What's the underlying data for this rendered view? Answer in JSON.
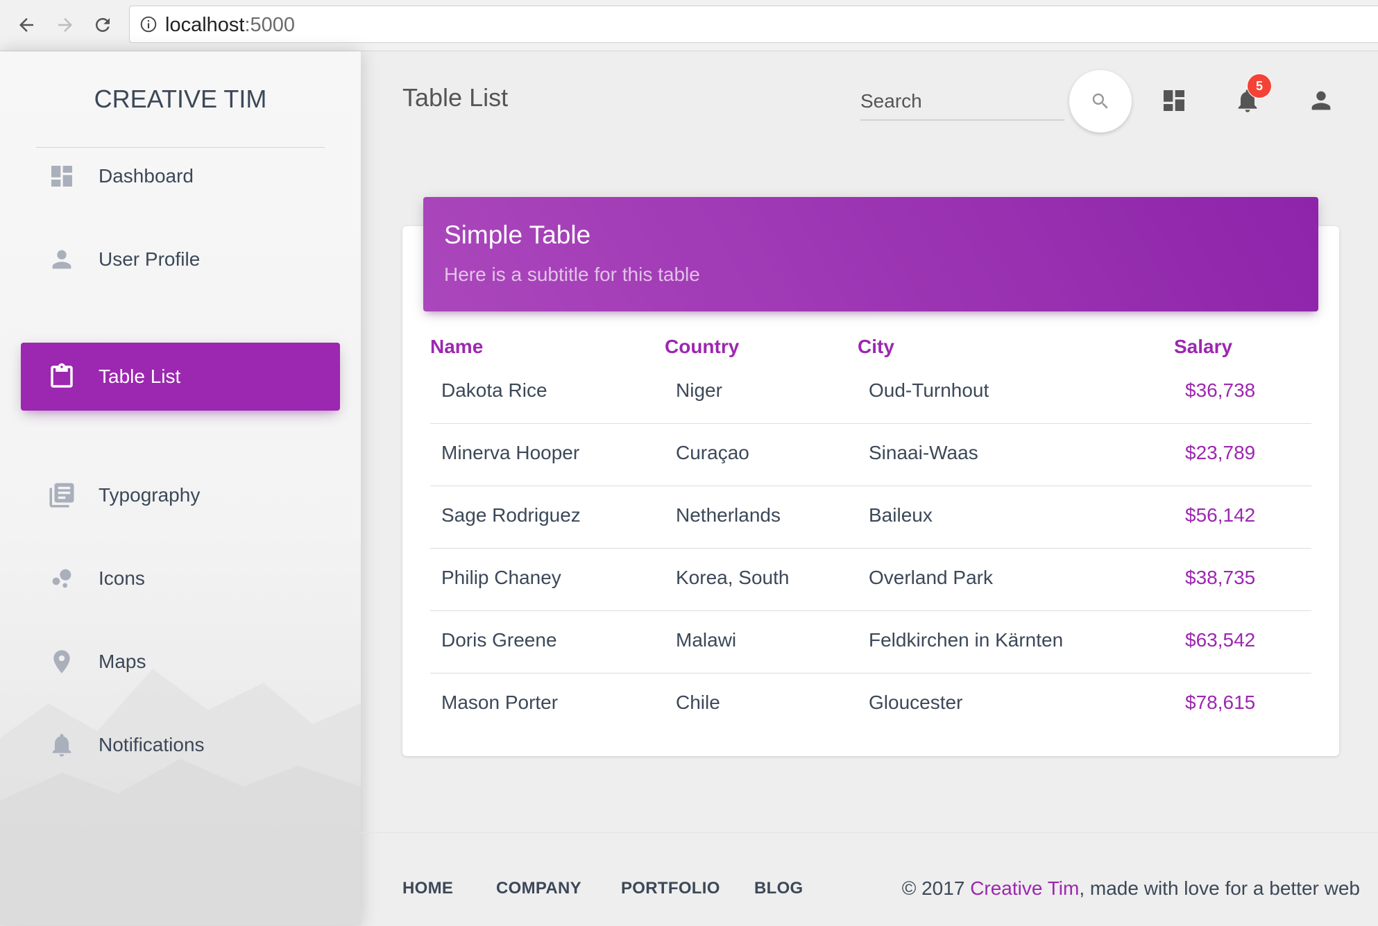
{
  "browser": {
    "url_host": "localhost",
    "url_port": ":5000",
    "icons": [
      "back-arrow-icon",
      "forward-arrow-icon",
      "reload-icon",
      "info-icon"
    ]
  },
  "sidebar": {
    "brand": "CREATIVE TIM",
    "active_color": "#9c27b0",
    "items": [
      {
        "label": "Dashboard",
        "icon": "dashboard-icon",
        "active": false
      },
      {
        "label": "User Profile",
        "icon": "person-icon",
        "active": false
      },
      {
        "label": "Table List",
        "icon": "clipboard-icon",
        "active": true
      },
      {
        "label": "Typography",
        "icon": "library-books-icon",
        "active": false
      },
      {
        "label": "Icons",
        "icon": "bubble-chart-icon",
        "active": false
      },
      {
        "label": "Maps",
        "icon": "location-pin-icon",
        "active": false
      },
      {
        "label": "Notifications",
        "icon": "bell-icon",
        "active": false
      }
    ]
  },
  "header": {
    "title": "Table List",
    "search_placeholder": "Search",
    "notification_count": "5",
    "icons": [
      "search-icon",
      "dashboard-icon",
      "bell-icon",
      "person-icon"
    ]
  },
  "card": {
    "title": "Simple Table",
    "subtitle": "Here is a subtitle for this table",
    "header_gradient": [
      "#ab47bc",
      "#8e24aa"
    ],
    "columns": [
      "Name",
      "Country",
      "City",
      "Salary"
    ],
    "rows": [
      [
        "Dakota Rice",
        "Niger",
        "Oud-Turnhout",
        "$36,738"
      ],
      [
        "Minerva Hooper",
        "Curaçao",
        "Sinaai-Waas",
        "$23,789"
      ],
      [
        "Sage Rodriguez",
        "Netherlands",
        "Baileux",
        "$56,142"
      ],
      [
        "Philip Chaney",
        "Korea, South",
        "Overland Park",
        "$38,735"
      ],
      [
        "Doris Greene",
        "Malawi",
        "Feldkirchen in Kärnten",
        "$63,542"
      ],
      [
        "Mason Porter",
        "Chile",
        "Gloucester",
        "$78,615"
      ]
    ]
  },
  "footer": {
    "links": [
      "Home",
      "Company",
      "Portfolio",
      "Blog"
    ],
    "copyright_prefix": "© 2017 ",
    "copyright_name": "Creative Tim",
    "copyright_suffix": ", made with love for a better web"
  }
}
